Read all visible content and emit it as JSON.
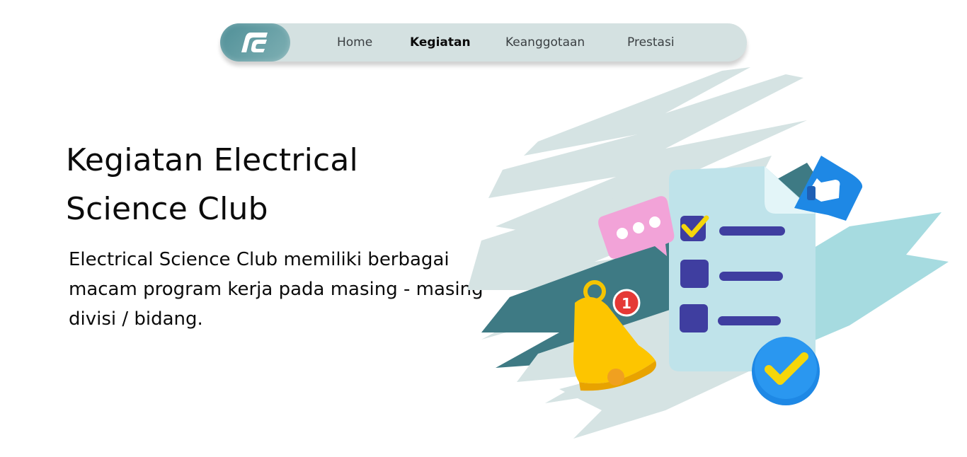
{
  "nav": {
    "logo_label": "ESC logo",
    "items": [
      {
        "label": "Home",
        "active": false
      },
      {
        "label": "Kegiatan",
        "active": true
      },
      {
        "label": "Keanggotaan",
        "active": false
      },
      {
        "label": "Prestasi",
        "active": false
      }
    ]
  },
  "hero": {
    "title_line1": "Kegiatan Electrical",
    "title_line2": "Science Club",
    "description": "Electrical Science Club memiliki berbagai macam program kerja pada masing - masing divisi / bidang."
  },
  "illustration": {
    "notification_count": "1"
  },
  "colors": {
    "nav_bg": "#d4e1e1",
    "logo_bg": "#5f9aa1",
    "brush_light": "#d5e3e3",
    "brush_dark": "#3e7a84",
    "brush_teal": "#a6dbe0",
    "accent_yellow": "#f5d60a",
    "accent_blue": "#1e88e5"
  }
}
